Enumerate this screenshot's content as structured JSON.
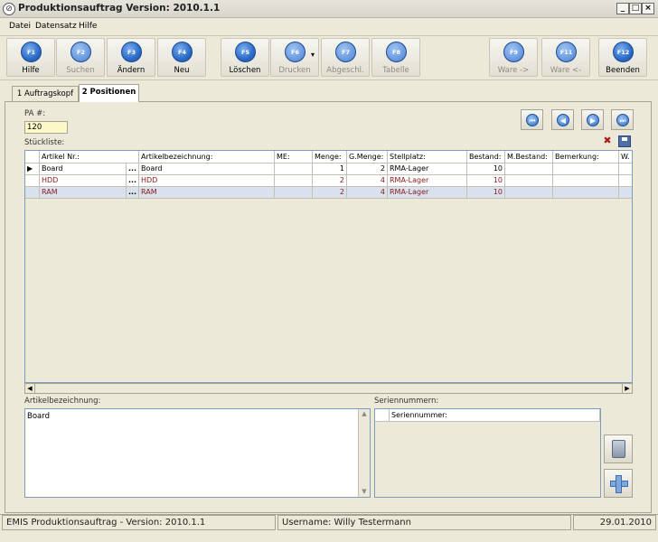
{
  "window": {
    "title": "Produktionsauftrag Version: 2010.1.1",
    "controls": [
      "_",
      "□",
      "×"
    ]
  },
  "menu": [
    "Datei",
    "Datensatz",
    "Hilfe"
  ],
  "toolbar": [
    {
      "key": "F1",
      "label": "Hilfe",
      "enabled": true
    },
    {
      "key": "F2",
      "label": "Suchen",
      "enabled": false
    },
    {
      "key": "F3",
      "label": "Ändern",
      "enabled": true
    },
    {
      "key": "F4",
      "label": "Neu",
      "enabled": true
    },
    {
      "key": "F5",
      "label": "Löschen",
      "enabled": true
    },
    {
      "key": "F6",
      "label": "Drucken",
      "enabled": false
    },
    {
      "key": "F7",
      "label": "Abgeschl.",
      "enabled": false
    },
    {
      "key": "F8",
      "label": "Tabelle",
      "enabled": false
    },
    {
      "key": "F9",
      "label": "Ware ->",
      "enabled": false
    },
    {
      "key": "F11",
      "label": "Ware <-",
      "enabled": false
    },
    {
      "key": "F12",
      "label": "Beenden",
      "enabled": true
    }
  ],
  "tabs": [
    "1 Auftragskopf",
    "2 Positionen"
  ],
  "pa": {
    "label": "PA #:",
    "value": "120"
  },
  "stueckliste_label": "Stückliste:",
  "grid": {
    "columns": [
      "Artikel Nr.:",
      "Artikelbezeichnung:",
      "ME:",
      "Menge:",
      "G.Menge:",
      "Stellplatz:",
      "Bestand:",
      "M.Bestand:",
      "Bemerkung:",
      "W."
    ],
    "rows": [
      {
        "artikel": "Board",
        "bez": "Board",
        "me": "",
        "menge": "1",
        "gmenge": "2",
        "stellplatz": "RMA-Lager",
        "bestand": "10",
        "style": "normal"
      },
      {
        "artikel": "HDD",
        "bez": "HDD",
        "me": "",
        "menge": "2",
        "gmenge": "4",
        "stellplatz": "RMA-Lager",
        "bestand": "10",
        "style": "red"
      },
      {
        "artikel": "RAM",
        "bez": "RAM",
        "me": "",
        "menge": "2",
        "gmenge": "4",
        "stellplatz": "RMA-Lager",
        "bestand": "10",
        "style": "red-selected"
      }
    ]
  },
  "bottom": {
    "desc_label": "Artikelbezeichnung:",
    "desc_value": "Board",
    "serial_label": "Seriennummern:",
    "serial_column": "Seriennummer:"
  },
  "status": {
    "app": "EMIS Produktionsauftrag - Version: 2010.1.1",
    "user": "Username: Willy Testermann",
    "date": "29.01.2010"
  },
  "colors": {
    "fkey_blue": "#2a6bc8",
    "pa_field": "#fdf8c8",
    "red_text": "#8b1a1a",
    "selected_row": "#d9e1ed"
  }
}
